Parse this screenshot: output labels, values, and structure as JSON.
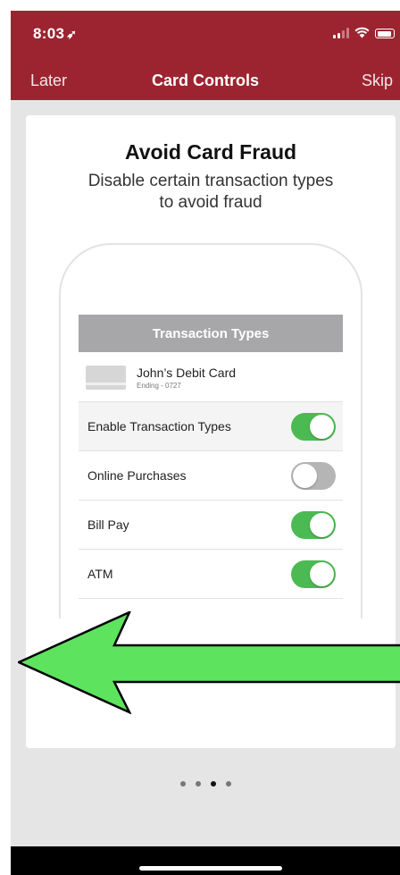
{
  "status_bar": {
    "time": "8:03",
    "location_icon": "location-arrow-icon",
    "signal_icon": "cellular-signal-icon",
    "wifi_icon": "wifi-icon",
    "battery_icon": "battery-icon"
  },
  "navigation": {
    "left": "Later",
    "title": "Card Controls",
    "right": "Skip"
  },
  "onboarding": {
    "headline": "Avoid Card Fraud",
    "subheadline": "Disable certain transaction types to avoid fraud",
    "illustration": {
      "header": "Transaction Types",
      "card_name": "John’s Debit Card",
      "card_ending": "Ending - 0727",
      "rows": [
        {
          "label": "Enable Transaction Types",
          "enabled": true
        },
        {
          "label": "Online Purchases",
          "enabled": false
        },
        {
          "label": "Bill Pay",
          "enabled": true
        },
        {
          "label": "ATM",
          "enabled": true
        }
      ]
    },
    "swipe_hint_icon": "left-arrow-icon",
    "swipe_arrow_color": "#5ee35e"
  },
  "pagination": {
    "pages": 4,
    "current_page": 3
  },
  "colors": {
    "brand": "#9c2430",
    "toggle_on": "#4cba52",
    "toggle_off": "#b5b5b5",
    "background": "#e6e5e6"
  }
}
